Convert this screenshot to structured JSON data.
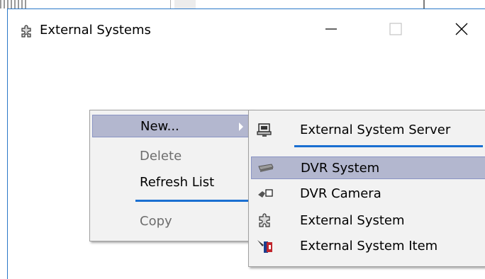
{
  "window": {
    "title": "External Systems",
    "controls": {
      "minimize": "minimize",
      "maximize": "maximize",
      "close": "close"
    }
  },
  "context_menu": {
    "items": [
      {
        "label": "New...",
        "has_submenu": true,
        "highlighted": true,
        "enabled": true
      },
      {
        "label": "Delete",
        "enabled": false
      },
      {
        "label": "Refresh List",
        "enabled": true
      },
      {
        "label": "Copy",
        "enabled": false
      }
    ]
  },
  "submenu": {
    "items": [
      {
        "label": "External System Server",
        "icon": "server-icon"
      },
      {
        "label": "DVR System",
        "icon": "dvr-system-icon",
        "highlighted": true
      },
      {
        "label": "DVR Camera",
        "icon": "camera-icon"
      },
      {
        "label": "External System",
        "icon": "external-system-icon"
      },
      {
        "label": "External System Item",
        "icon": "external-system-item-icon"
      }
    ]
  },
  "colors": {
    "highlight": "#b3b7cf",
    "separator": "#1a6fd1",
    "menu_bg": "#f2f2f2",
    "window_border": "#2b78c8"
  }
}
